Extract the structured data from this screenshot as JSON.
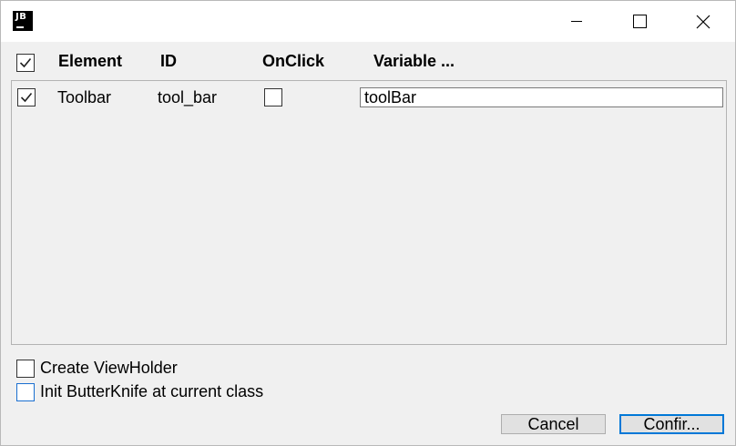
{
  "titlebar": {
    "logo_text": "JB",
    "icons": {
      "minimize": "minimize-icon",
      "maximize": "maximize-icon",
      "close": "close-icon"
    }
  },
  "header": {
    "select_all_checked": true,
    "element": "Element",
    "id": "ID",
    "onclick": "OnClick",
    "variable": "Variable ..."
  },
  "rows": [
    {
      "checked": true,
      "element": "Toolbar",
      "id": "tool_bar",
      "onclick_checked": false,
      "variable": "toolBar"
    }
  ],
  "options": {
    "create_viewholder": {
      "label": "Create ViewHolder",
      "checked": false
    },
    "init_butterknife": {
      "label": "Init ButterKnife at current class",
      "checked": false
    }
  },
  "buttons": {
    "cancel": "Cancel",
    "confirm": "Confir..."
  },
  "colors": {
    "focus_border": "#0078d7",
    "window_bg": "#f0f0f0"
  }
}
